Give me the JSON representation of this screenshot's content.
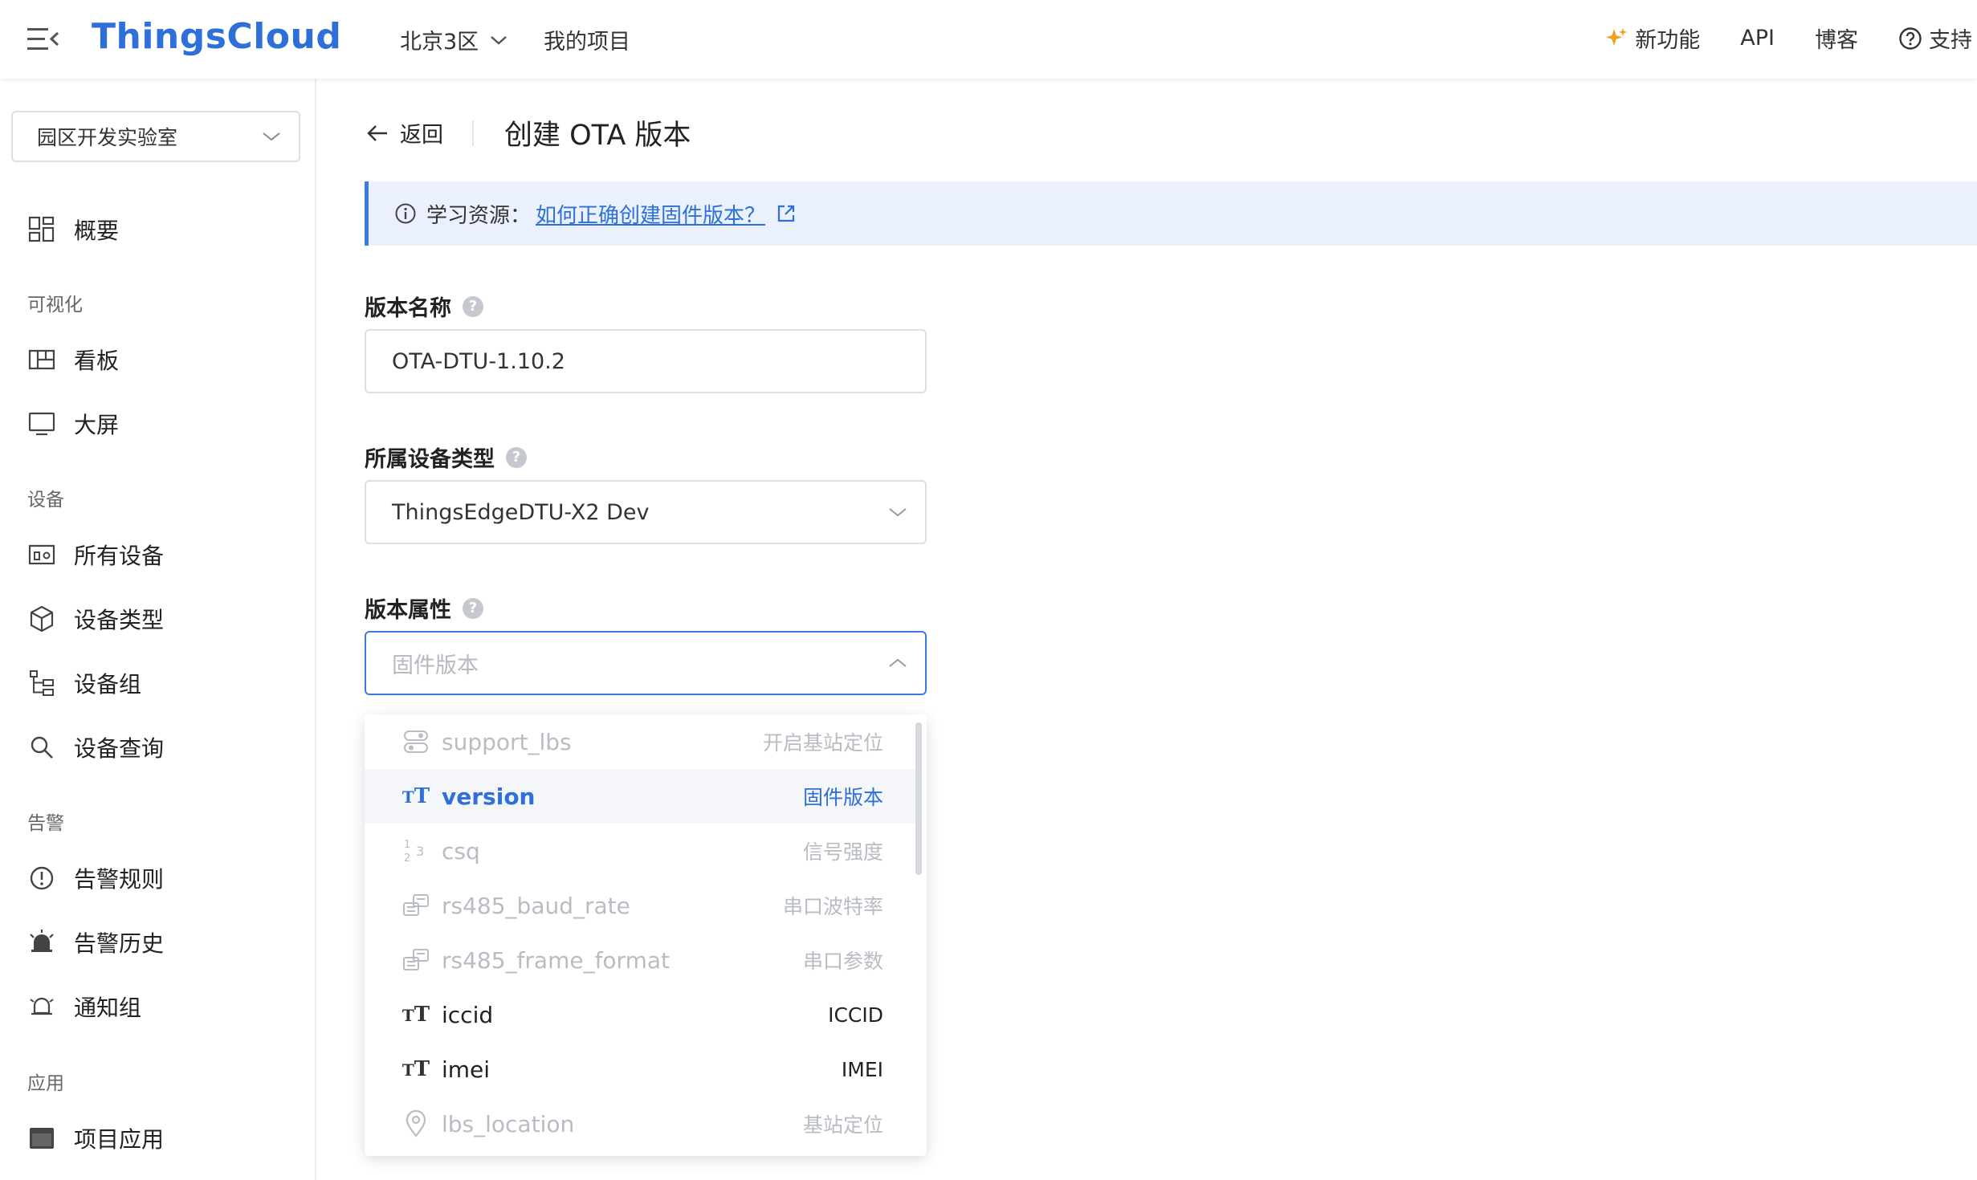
{
  "topbar": {
    "brand": "ThingsCloud",
    "region": "北京3区",
    "my_projects": "我的项目",
    "new_features": "新功能",
    "api": "API",
    "blog": "博客",
    "support": "支持"
  },
  "sidebar": {
    "project": "园区开发实验室",
    "overview": "概要",
    "group_visual": "可视化",
    "dashboard": "看板",
    "big_screen": "大屏",
    "group_device": "设备",
    "all_devices": "所有设备",
    "device_types": "设备类型",
    "device_groups": "设备组",
    "device_query": "设备查询",
    "group_alarm": "告警",
    "alarm_rules": "告警规则",
    "alarm_history": "告警历史",
    "notify_groups": "通知组",
    "group_app": "应用",
    "project_apps": "项目应用"
  },
  "page": {
    "back": "返回",
    "title": "创建 OTA 版本",
    "banner_prefix": "学习资源：",
    "banner_link": "如何正确创建固件版本？"
  },
  "form": {
    "version_name_label": "版本名称",
    "version_name_value": "OTA-DTU-1.10.2",
    "device_type_label": "所属设备类型",
    "device_type_value": "ThingsEdgeDTU-X2 Dev",
    "version_attr_label": "版本属性",
    "version_attr_placeholder": "固件版本"
  },
  "options": [
    {
      "key": "support_lbs",
      "desc": "开启基站定位",
      "state": "disabled",
      "icon": "toggle-icon"
    },
    {
      "key": "version",
      "desc": "固件版本",
      "state": "active",
      "icon": "text-type-icon"
    },
    {
      "key": "csq",
      "desc": "信号强度",
      "state": "disabled",
      "icon": "number-type-icon"
    },
    {
      "key": "rs485_baud_rate",
      "desc": "串口波特率",
      "state": "disabled",
      "icon": "enum-type-icon"
    },
    {
      "key": "rs485_frame_format",
      "desc": "串口参数",
      "state": "disabled",
      "icon": "enum-type-icon"
    },
    {
      "key": "iccid",
      "desc": "ICCID",
      "state": "normal",
      "icon": "text-type-icon"
    },
    {
      "key": "imei",
      "desc": "IMEI",
      "state": "normal",
      "icon": "text-type-icon"
    },
    {
      "key": "lbs_location",
      "desc": "基站定位",
      "state": "disabled",
      "icon": "location-icon"
    }
  ],
  "colors": {
    "brand": "#2e6fd9",
    "accent": "#3a7be0",
    "banner_bg": "#eaf1fd",
    "disabled_text": "#b8bcc3"
  }
}
